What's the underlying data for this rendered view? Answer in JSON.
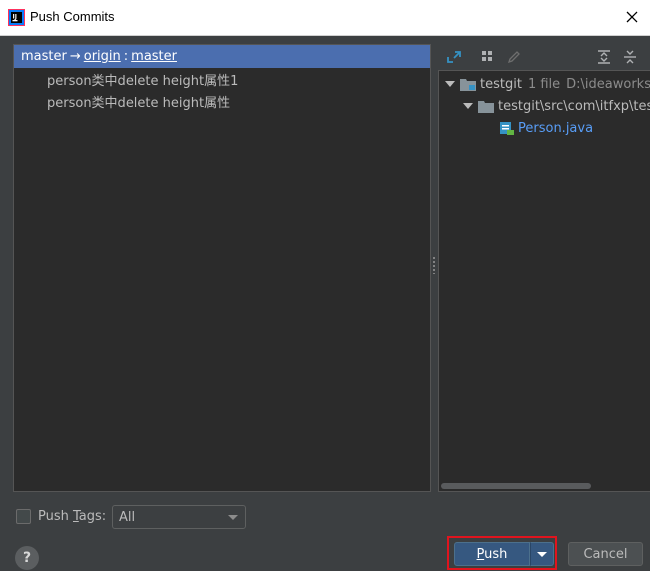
{
  "window": {
    "title": "Push Commits",
    "app_icon": "intellij-idea-icon",
    "close_icon": "close-icon"
  },
  "commits_panel": {
    "branch": {
      "local": "master",
      "arrow": "→",
      "remote": "origin",
      "separator": ":",
      "remote_branch": "master"
    },
    "commits": [
      {
        "message": "person类中delete height属性1"
      },
      {
        "message": "person类中delete height属性"
      }
    ]
  },
  "changes_panel": {
    "toolbar_icons": [
      "diff-arrows-icon",
      "group-by-icon",
      "edit-icon",
      "expand-all-icon",
      "collapse-all-icon"
    ],
    "tree": {
      "root": {
        "name": "testgit",
        "count": "1 file",
        "path": "D:\\ideaworksp"
      },
      "folder": {
        "name": "testgit\\src\\com\\itfxp\\tes"
      },
      "file": {
        "name": "Person.java"
      }
    }
  },
  "options": {
    "push_tags_prefix": "Push ",
    "push_tags_mnemonic": "T",
    "push_tags_suffix": "ags:",
    "push_tags_checked": false,
    "tags_select_value": "All"
  },
  "footer": {
    "help_label": "?",
    "push_mnemonic": "P",
    "push_rest": "ush",
    "cancel_label": "Cancel"
  },
  "colors": {
    "selection": "#4b6eaf",
    "push_button": "#365880",
    "highlight_border": "#e0141e",
    "file_link": "#589df6"
  }
}
